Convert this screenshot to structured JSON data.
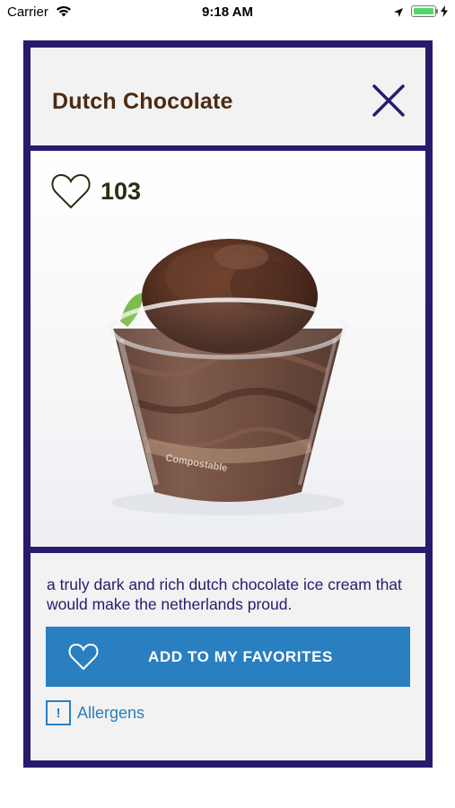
{
  "status_bar": {
    "carrier": "Carrier",
    "time": "9:18 AM"
  },
  "item": {
    "title": "Dutch Chocolate",
    "likes": "103",
    "image_alt": "chocolate ice cream cup",
    "cup_print": "Compostable",
    "description": "a truly dark and rich dutch chocolate ice cream that would make the netherlands proud."
  },
  "actions": {
    "favorite_label": "ADD TO MY FAVORITES",
    "allergens_label": "Allergens",
    "allergen_icon_glyph": "!"
  },
  "colors": {
    "frame": "#2a1a6e",
    "title": "#4a2a12",
    "button": "#2a7fc1",
    "panel": "#f2f2f2"
  },
  "icons": [
    "wifi-icon",
    "location-icon",
    "battery-icon",
    "close-icon",
    "heart-outline-icon",
    "heart-outline-white-icon",
    "allergen-warning-icon"
  ]
}
